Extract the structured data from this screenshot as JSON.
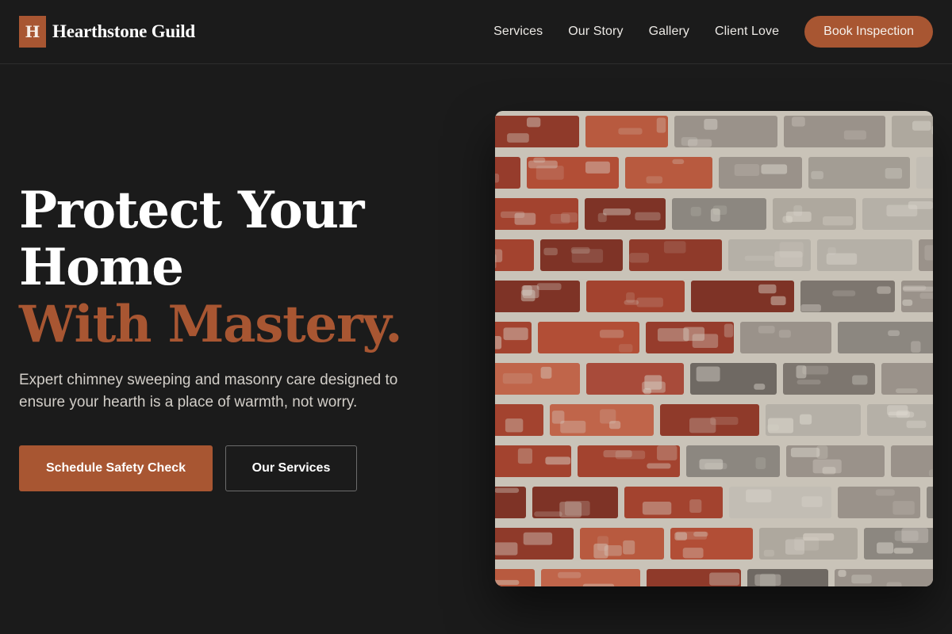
{
  "header": {
    "logo_letter": "H",
    "brand_name": "Hearthstone Guild",
    "nav": [
      {
        "label": "Services"
      },
      {
        "label": "Our Story"
      },
      {
        "label": "Gallery"
      },
      {
        "label": "Client Love"
      }
    ],
    "cta_label": "Book Inspection"
  },
  "hero": {
    "headline_line1": "Protect Your",
    "headline_line2": "Home",
    "headline_accent": "With Mastery.",
    "lede": "Expert chimney sweeping and masonry care designed to ensure your hearth is a place of warmth, not worry.",
    "primary_cta": "Schedule Safety Check",
    "secondary_cta": "Our Services"
  },
  "media": {
    "image_subject": "weathered red and white brick wall",
    "image_icon": "brick-wall-photo"
  },
  "colors": {
    "background": "#1b1b1b",
    "accent": "#a85632",
    "text_primary": "#ffffff",
    "text_secondary": "#d2cec8"
  }
}
